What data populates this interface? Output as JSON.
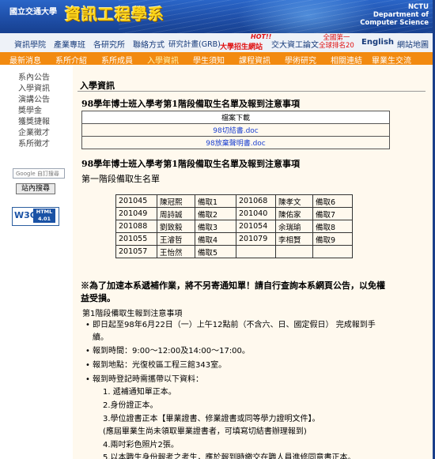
{
  "banner": {
    "university": "國立交通大學",
    "department": "資訊工程學系",
    "english": [
      "NCTU",
      "Department of",
      "Computer Science"
    ]
  },
  "topnav": {
    "items": [
      "資訊學院",
      "產業專班",
      "各研究所",
      "聯絡方式",
      "研究計畫(GRB)"
    ],
    "admission": "大學招生網站",
    "hot": "HOT!!",
    "thesis": "交大資工論文",
    "rank": [
      "全國第一",
      "全球排名20"
    ],
    "english": "English",
    "sitemap": "網站地圖"
  },
  "orangenav": [
    "最新消息",
    "系所介紹",
    "系所成員",
    "入學資訊",
    "學生須知",
    "課程資訊",
    "學術研究",
    "相關連結",
    "畢業生交流"
  ],
  "sidebar": {
    "links": [
      "系內公告",
      "入學資訊",
      "演講公告",
      "獎學金",
      "獲獎捷報",
      "企業徵才",
      "系所徵才"
    ],
    "google_placeholder": "Google 自訂搜尋",
    "search_button": "站內搜尋",
    "w3c": "W3C",
    "html_badge": [
      "HTML",
      "4.01"
    ]
  },
  "content": {
    "heading": "入學資訊",
    "subhead1": "98學年博士班入學考第1階段備取生名單及報到注意事項",
    "download_header": "檔案下載",
    "downloads": [
      "98切結書.doc",
      "98放棄聲明書.doc"
    ],
    "subhead2": "98學年博士班入學考第1階段備取生名單及報到注意事項",
    "phase_title": "第一階段備取生名單",
    "candidates": [
      [
        "201045",
        "陳冠熙",
        "備取1",
        "201068",
        "陳孝文",
        "備取6"
      ],
      [
        "201049",
        "周詩誠",
        "備取2",
        "201040",
        "陳佑家",
        "備取7"
      ],
      [
        "201088",
        "劉致毅",
        "備取3",
        "201054",
        "余瑞瑜",
        "備取8"
      ],
      [
        "201055",
        "王濬哲",
        "備取4",
        "201079",
        "李相賢",
        "備取9"
      ],
      [
        "201057",
        "王怡然",
        "備取5",
        "",
        "",
        ""
      ]
    ],
    "notice": "※為了加速本系遞補作業，將不另寄通知單！請自行查詢本系網頁公告，以免權益受損。",
    "reg_title": "第1階段備取生報到注意事項",
    "bullets": [
      "即日起至98年6月22日（一）上午12點前（不含六、日、國定假日） 完成報到手續。",
      "報到時間：9:00～12:00及14:00～17:00。",
      "報到地點：光復校區工程三館343室。",
      "報到時登記時需攜帶以下資料："
    ],
    "subitems": [
      "1. 遞補通知單正本。",
      "2.身份證正本。",
      "3.學位證書正本【畢業證書、修業證書或同等學力證明文件】。",
      "(應屆畢業生尚未領取畢業證書者，可填寫切結書辦理報到)",
      "4.兩吋彩色照片2張。",
      "5.以本職生身份報考之考生，應於報到時繳交在職人員進修同意書正本。"
    ]
  }
}
